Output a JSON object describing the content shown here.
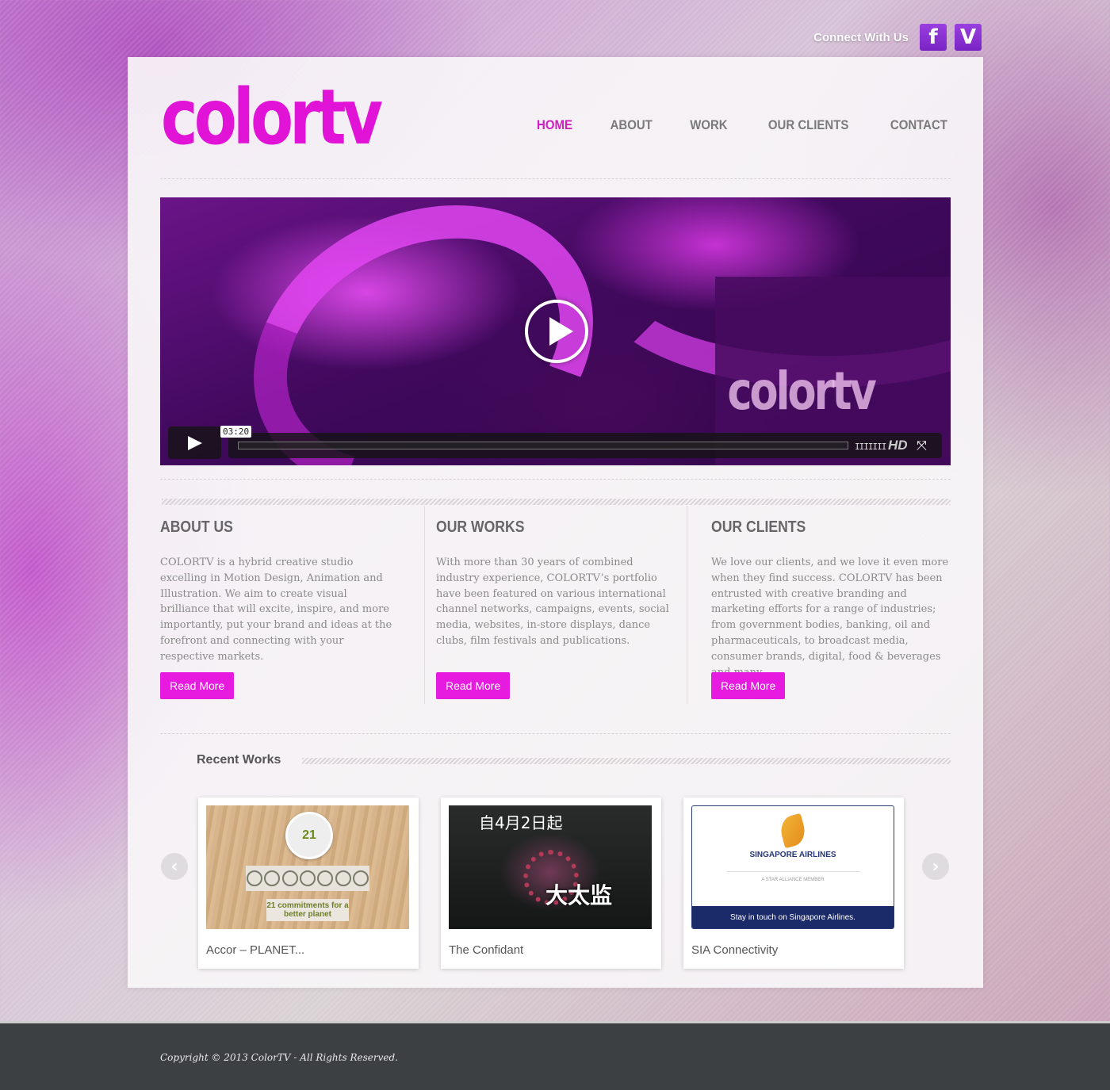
{
  "header": {
    "connect_label": "Connect With Us",
    "social": [
      {
        "icon": "facebook-icon",
        "glyph": "f"
      },
      {
        "icon": "vimeo-icon",
        "glyph": "V"
      }
    ]
  },
  "logo_text": "colortv",
  "nav": [
    "HOME",
    "ABOUT",
    "WORK",
    "OUR CLIENTS",
    "CONTACT"
  ],
  "nav_active": "HOME",
  "video": {
    "watermark": "colortv",
    "time": "03:20",
    "hd_label": "HD",
    "volume_glyph": "IIIIIII",
    "fullscreen_glyph": "⤧"
  },
  "columns": [
    {
      "title": "ABOUT US",
      "body": "COLORTV is a hybrid creative studio excelling in Motion Design, Animation and Illustration. We aim to create visual brilliance that will excite, inspire, and more importantly, put your brand and ideas at the forefront and connecting with your respective markets.",
      "button": "Read More"
    },
    {
      "title": "OUR WORKS",
      "body": "With more than 30 years of combined industry experience, COLORTV’s portfolio have been featured on various international channel networks, campaigns, events, social media, websites, in-store displays, dance clubs, film festivals and publications.",
      "button": "Read More"
    },
    {
      "title": "OUR CLIENTS",
      "body": "We love our clients, and we love it even more when they find success. COLORTV has been entrusted with creative branding and marketing efforts for a range of industries; from government bodies, banking, oil and pharmaceuticals, to broadcast media, consumer brands, digital, food & beverages and many",
      "button": "Read More"
    }
  ],
  "recent_works": {
    "title": "Recent Works",
    "prev_glyph": "‹",
    "next_glyph": "›",
    "items": [
      {
        "label": "Accor – PLANET...",
        "thumb": {
          "badge": "21",
          "ribbon": "21 commitments for a better planet"
        }
      },
      {
        "label": "The Confidant",
        "thumb": {
          "line1": "自4月2日起",
          "line2": "大太监"
        }
      },
      {
        "label": "SIA Connectivity",
        "thumb": {
          "name": "SINGAPORE AIRLINES",
          "star": "A STAR ALLIANCE MEMBER",
          "bar": "Stay in touch on Singapore Airlines."
        }
      }
    ]
  },
  "footer": {
    "copyright": "Copyright © 2013 ColorTV - All Rights Reserved."
  },
  "colors": {
    "accent": "#e71be0",
    "nav_active": "#d01fc0",
    "footer_bg": "#3d4043"
  }
}
